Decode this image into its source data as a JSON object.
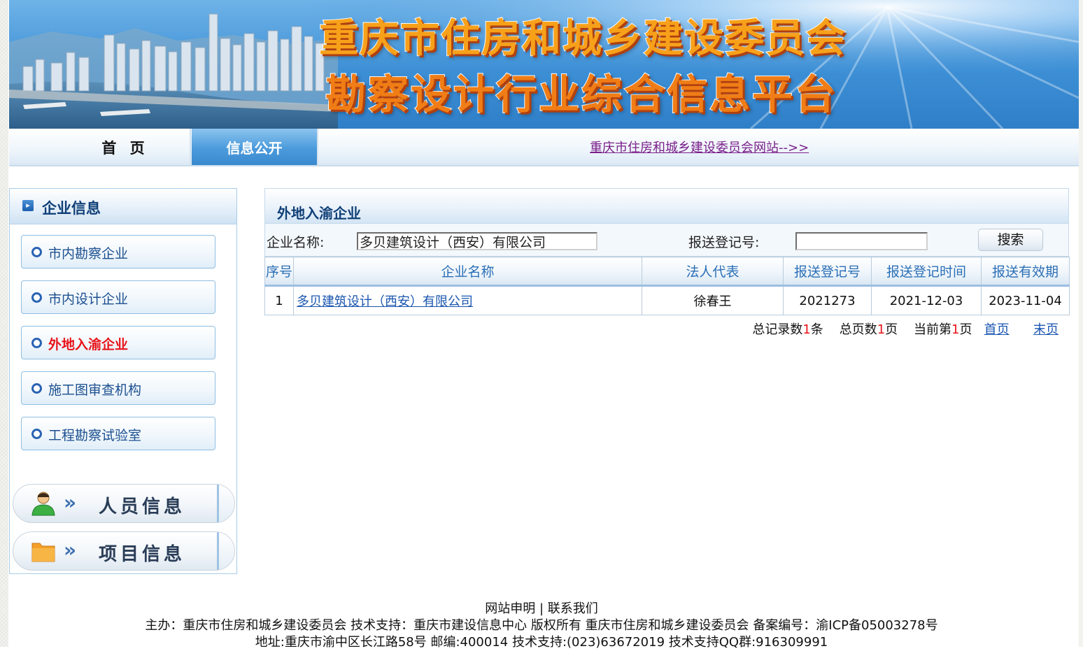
{
  "banner": {
    "title_line1": "重庆市住房和城乡建设委员会",
    "title_line2": "勘察设计行业综合信息平台"
  },
  "nav": {
    "home": "首 页",
    "info_public": "信息公开",
    "site_link": "重庆市住房和城乡建设委员会网站-->>"
  },
  "sidebar": {
    "header": "企业信息",
    "items": [
      {
        "label": "市内勘察企业",
        "active": false
      },
      {
        "label": "市内设计企业",
        "active": false
      },
      {
        "label": "外地入渝企业",
        "active": true
      },
      {
        "label": "施工图审查机构",
        "active": false
      },
      {
        "label": "工程勘察试验室",
        "active": false
      }
    ],
    "personnel": "人员信息",
    "projects": "项目信息"
  },
  "main": {
    "title": "外地入渝企业",
    "search": {
      "name_label": "企业名称:",
      "name_value": "多贝建筑设计（西安）有限公司",
      "reg_label": "报送登记号:",
      "reg_value": "",
      "button": "搜索"
    },
    "table": {
      "columns": [
        "序号",
        "企业名称",
        "法人代表",
        "报送登记号",
        "报送登记时间",
        "报送有效期"
      ],
      "rows": [
        [
          "1",
          "多贝建筑设计（西安）有限公司",
          "徐春王",
          "2021273",
          "2021-12-03",
          "2023-11-04"
        ]
      ]
    },
    "pager": {
      "total_records_prefix": "总记录数",
      "total_records": "1",
      "total_records_suffix": "条",
      "total_pages_prefix": "总页数",
      "total_pages": "1",
      "total_pages_suffix": "页",
      "current_prefix": "当前第",
      "current_page": "1",
      "current_suffix": "页",
      "first": "首页",
      "last": "末页"
    }
  },
  "footer": {
    "links": "网站申明 | 联系我们",
    "line1": "主办：重庆市住房和城乡建设委员会 技术支持：重庆市建设信息中心 版权所有 重庆市住房和城乡建设委员会 备案编号：渝ICP备05003278号",
    "line2": "地址:重庆市渝中区长江路58号 邮编:400014 技术支持:(023)63672019 技术支持QQ群:916309991"
  },
  "colors": {
    "accent_blue": "#2b6fb6",
    "active_red": "#e8141a",
    "nav_link_purple": "#7a1f8a",
    "title_orange": "#f07d15"
  }
}
